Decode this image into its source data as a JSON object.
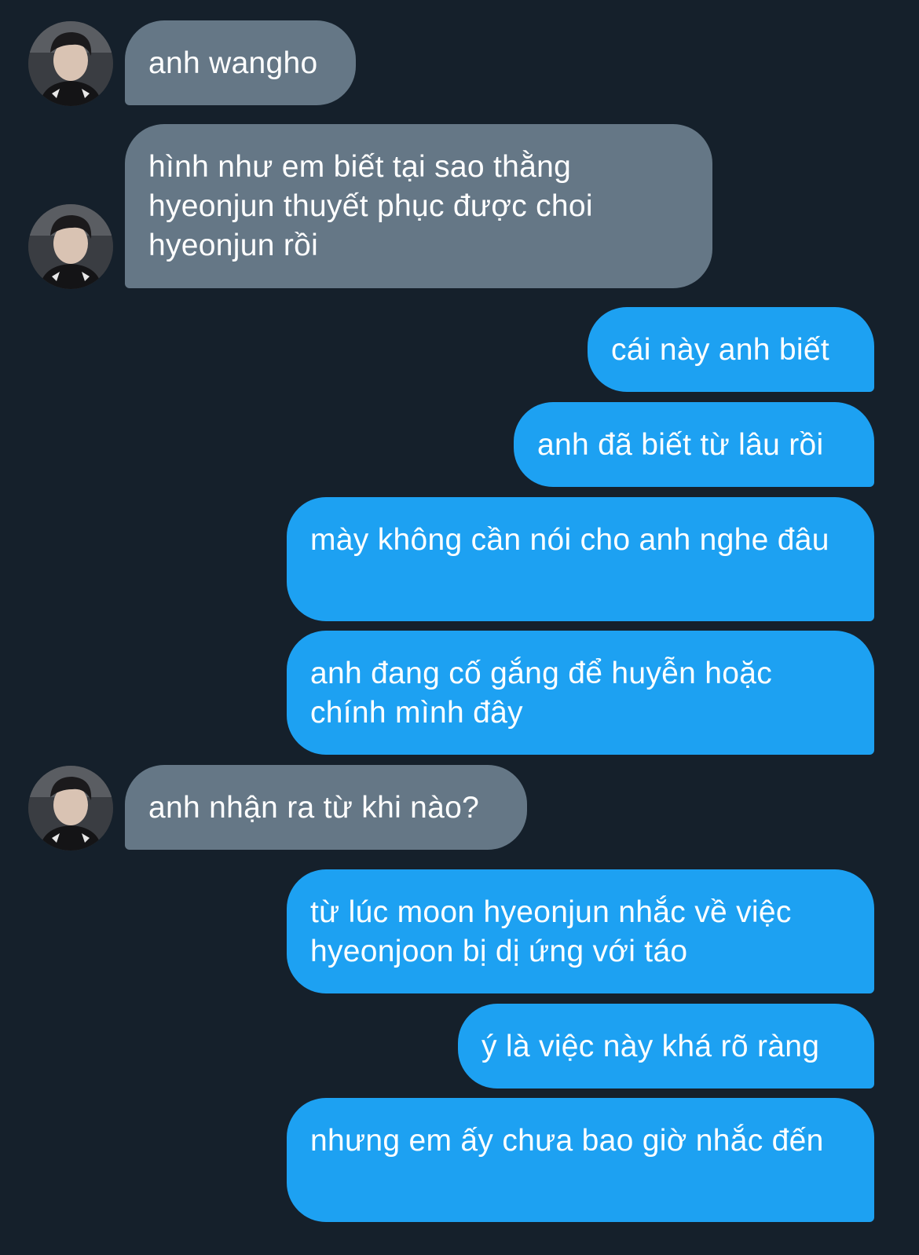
{
  "theme": {
    "background": "#15202b",
    "incoming_bubble": "#657786",
    "outgoing_bubble": "#1da1f2",
    "text": "#ffffff"
  },
  "avatar": {
    "icon": "profile-photo-icon"
  },
  "messages": [
    {
      "side": "in",
      "text": "anh wangho"
    },
    {
      "side": "in",
      "text": "hình như em biết tại sao thằng hyeonjun thuyết phục được choi hyeonjun rồi"
    },
    {
      "side": "out",
      "text": "cái này anh biết"
    },
    {
      "side": "out",
      "text": "anh đã biết từ lâu rồi"
    },
    {
      "side": "out",
      "text": "mày không cần nói cho anh nghe đâu"
    },
    {
      "side": "out",
      "text": "anh đang cố gắng để huyễn hoặc chính mình đây"
    },
    {
      "side": "in",
      "text": "anh nhận ra từ khi nào?"
    },
    {
      "side": "out",
      "text": "từ lúc moon hyeonjun nhắc về việc hyeonjoon bị dị ứng với táo"
    },
    {
      "side": "out",
      "text": "ý là việc này khá rõ ràng"
    },
    {
      "side": "out",
      "text": "nhưng em ấy chưa bao giờ nhắc đến"
    }
  ]
}
